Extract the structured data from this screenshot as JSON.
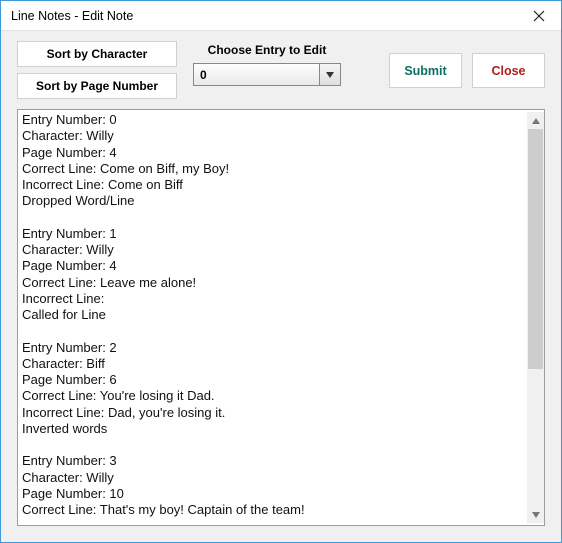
{
  "window": {
    "title": "Line Notes - Edit Note"
  },
  "buttons": {
    "sort_char": "Sort by Character",
    "sort_page": "Sort by Page Number",
    "submit": "Submit",
    "close": "Close"
  },
  "choose": {
    "label": "Choose Entry to Edit",
    "value": "0"
  },
  "labels": {
    "entry_number": "Entry Number:",
    "character": "Character:",
    "page_number": "Page Number:",
    "correct_line": "Correct Line:",
    "incorrect_line": "Incorrect Line:"
  },
  "entries": [
    {
      "number": "0",
      "character": "Willy",
      "page": "4",
      "correct": "Come on Biff, my Boy!",
      "incorrect": "Come on Biff",
      "note": "Dropped Word/Line"
    },
    {
      "number": "1",
      "character": "Willy",
      "page": "4",
      "correct": "Leave me alone!",
      "incorrect": "",
      "note": "Called for Line"
    },
    {
      "number": "2",
      "character": "Biff",
      "page": "6",
      "correct": "You're losing it Dad.",
      "incorrect": "Dad, you're losing it.",
      "note": "Inverted words"
    },
    {
      "number": "3",
      "character": "Willy",
      "page": "10",
      "correct": "That's my boy! Captain of the team!",
      "incorrect": null,
      "note": null
    }
  ]
}
